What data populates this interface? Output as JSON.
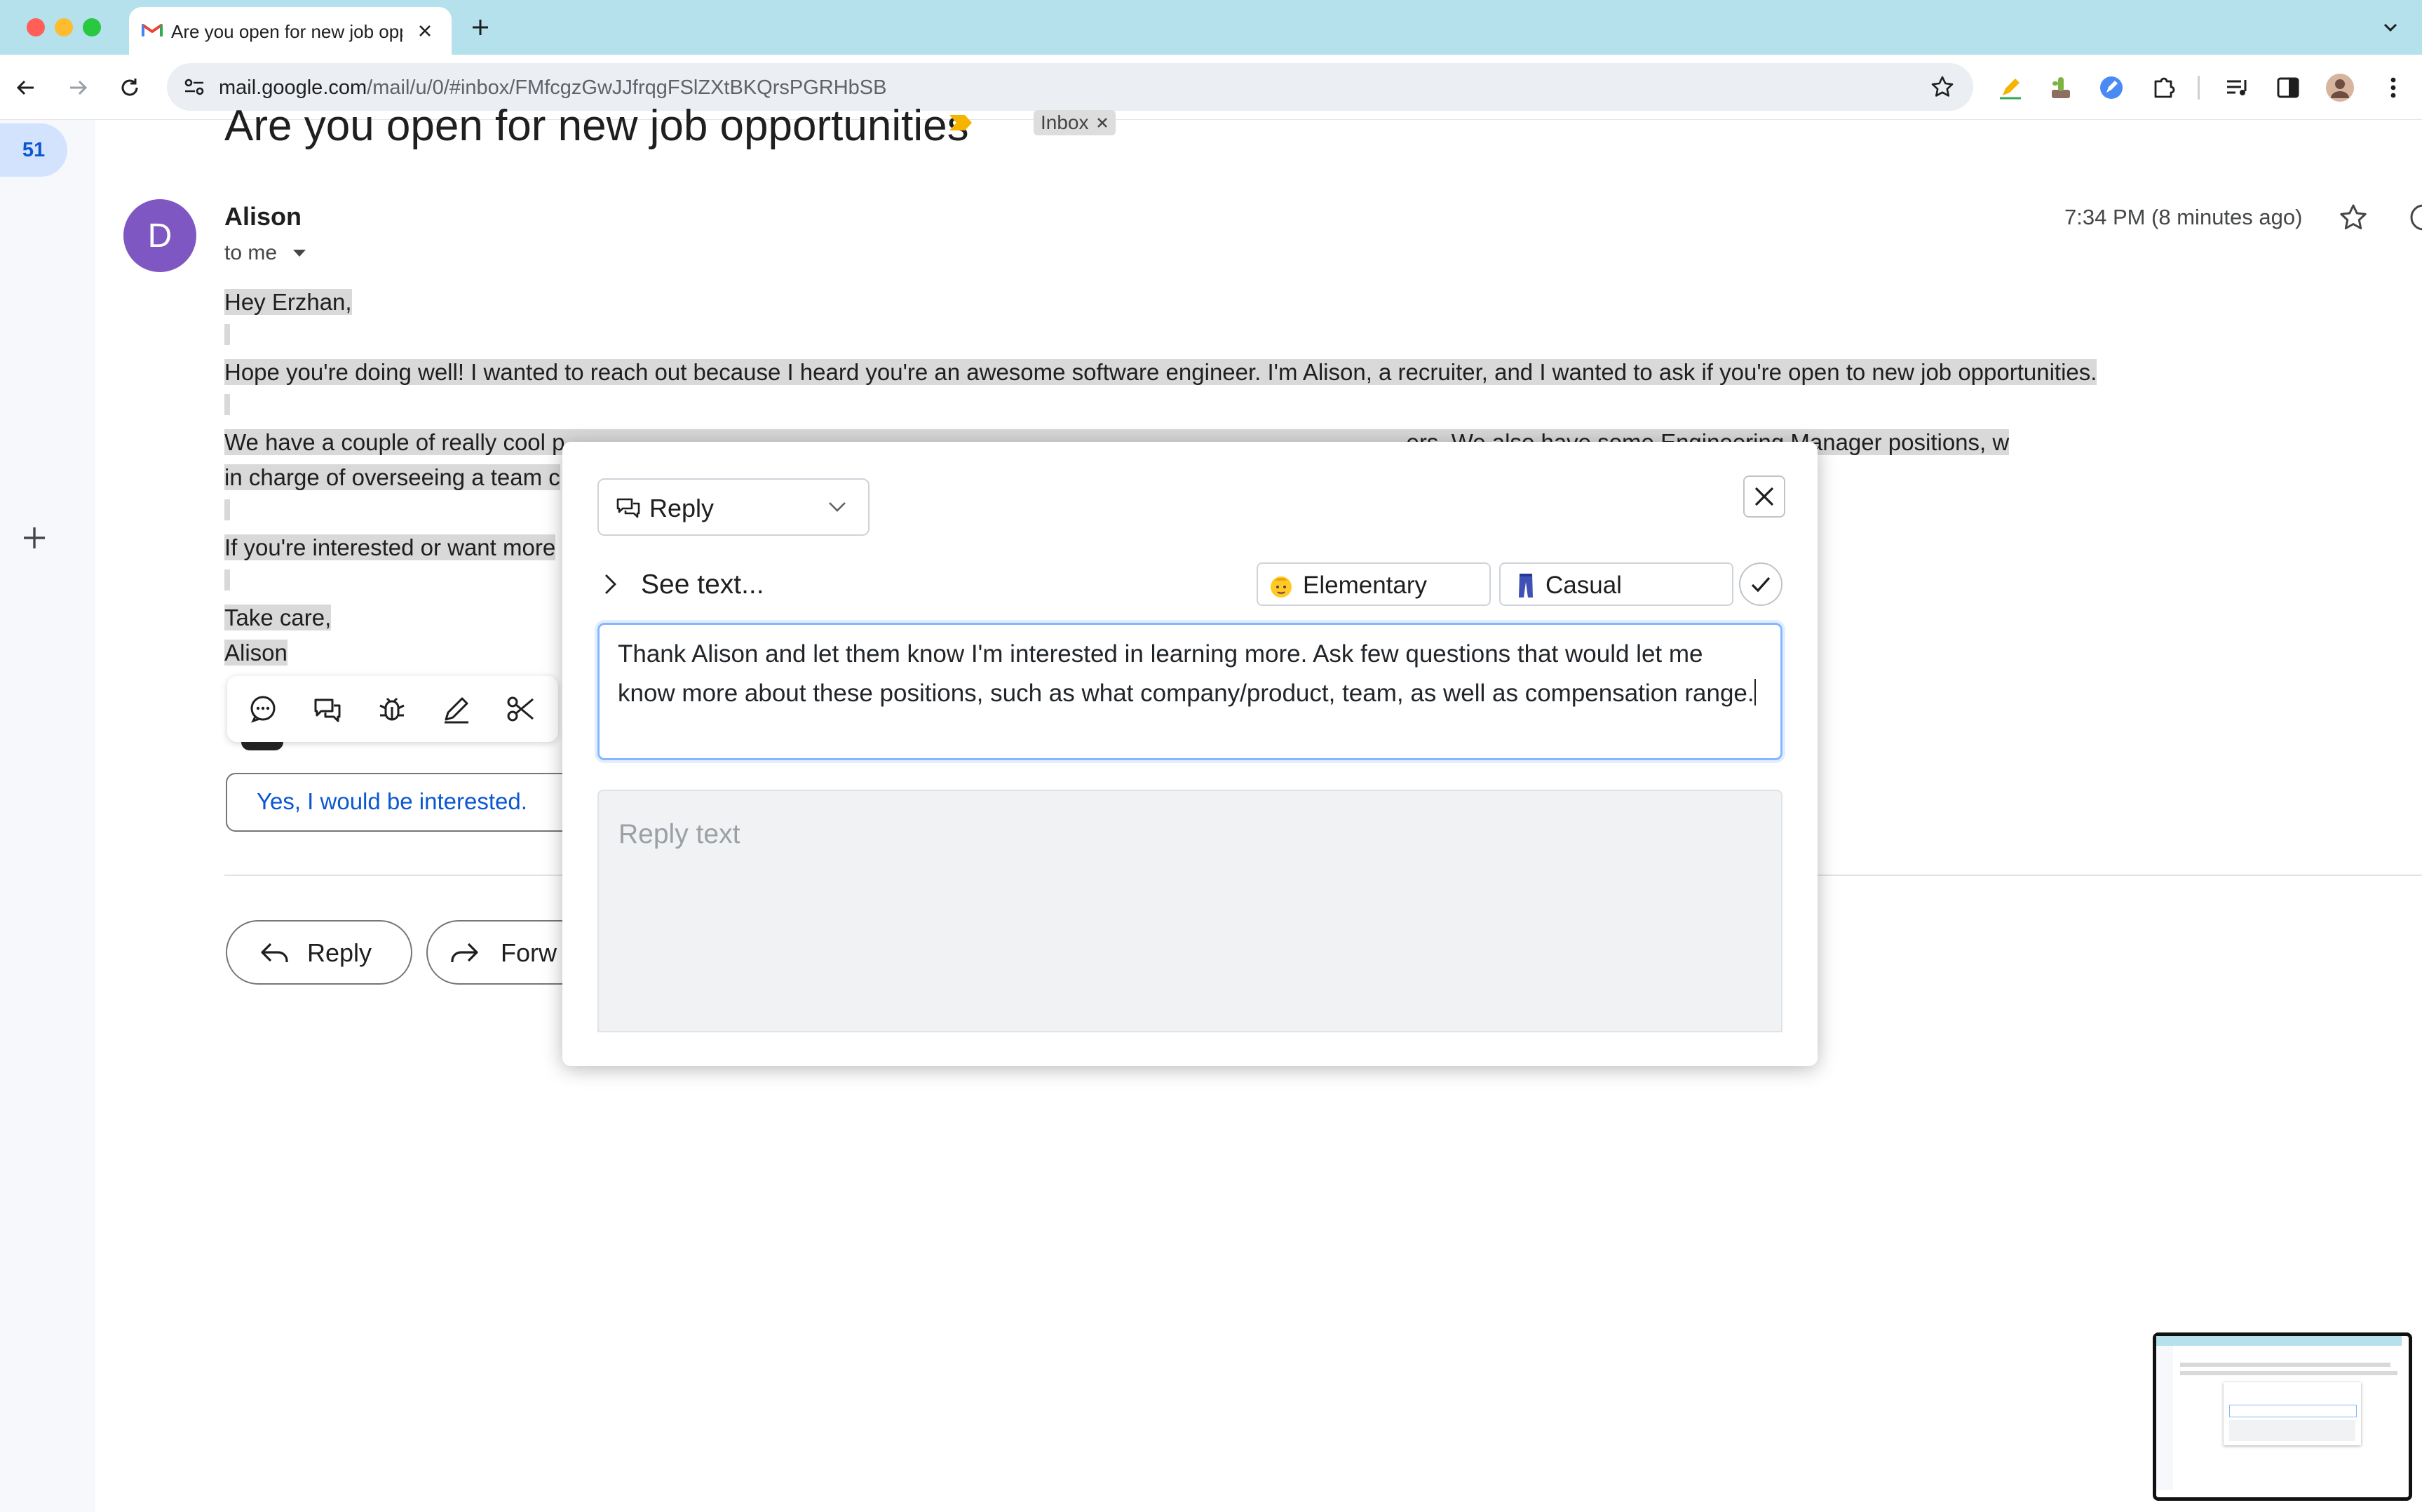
{
  "browser": {
    "tab_title": "Are you open for new job opp",
    "url_host": "mail.google.com",
    "url_path": "/mail/u/0/#inbox/FMfcgzGwJJfrqgFSlZXtBKQrsPGRHbSB"
  },
  "sidebar": {
    "unread_count": "51"
  },
  "email": {
    "subject": "Are you open for new job opportunities",
    "label_chip": "Inbox",
    "avatar_letter": "D",
    "sender": "Alison",
    "recipient": "to me",
    "time": "7:34 PM (8 minutes ago)",
    "body": {
      "greeting": "Hey Erzhan,",
      "p1": "Hope you're doing well! I wanted to reach out because I heard you're an awesome software engineer. I'm Alison, a recruiter, and I wanted to ask if you're open to new job opportunities.",
      "p2_line1": "We have a couple of really cool p",
      "p2_line1_tail": "ers. We also have some Engineering Manager positions, w",
      "p2_line2": "in charge of overseeing a team c",
      "p3": "If you're interested or want more",
      "signoff": "Take care,",
      "signature": "Alison"
    }
  },
  "smart_reply": "Yes, I would be interested.",
  "actions": {
    "reply": "Reply",
    "forward": "Forw"
  },
  "composer": {
    "mode": "Reply",
    "see_text": "See text...",
    "level": "Elementary",
    "tone": "Casual",
    "prompt": "Thank Alison and let them know I'm interested in learning more. Ask few questions that would let me know more about these positions, such as what company/product, team, as well as compensation range.",
    "reply_placeholder": "Reply text"
  },
  "colors": {
    "tabstrip": "#b5e1ec",
    "gmail_blue": "#0b57d0",
    "avatar": "#7e57c2",
    "highlight": "#d9d9d9",
    "focus_border": "#86b7fe"
  }
}
